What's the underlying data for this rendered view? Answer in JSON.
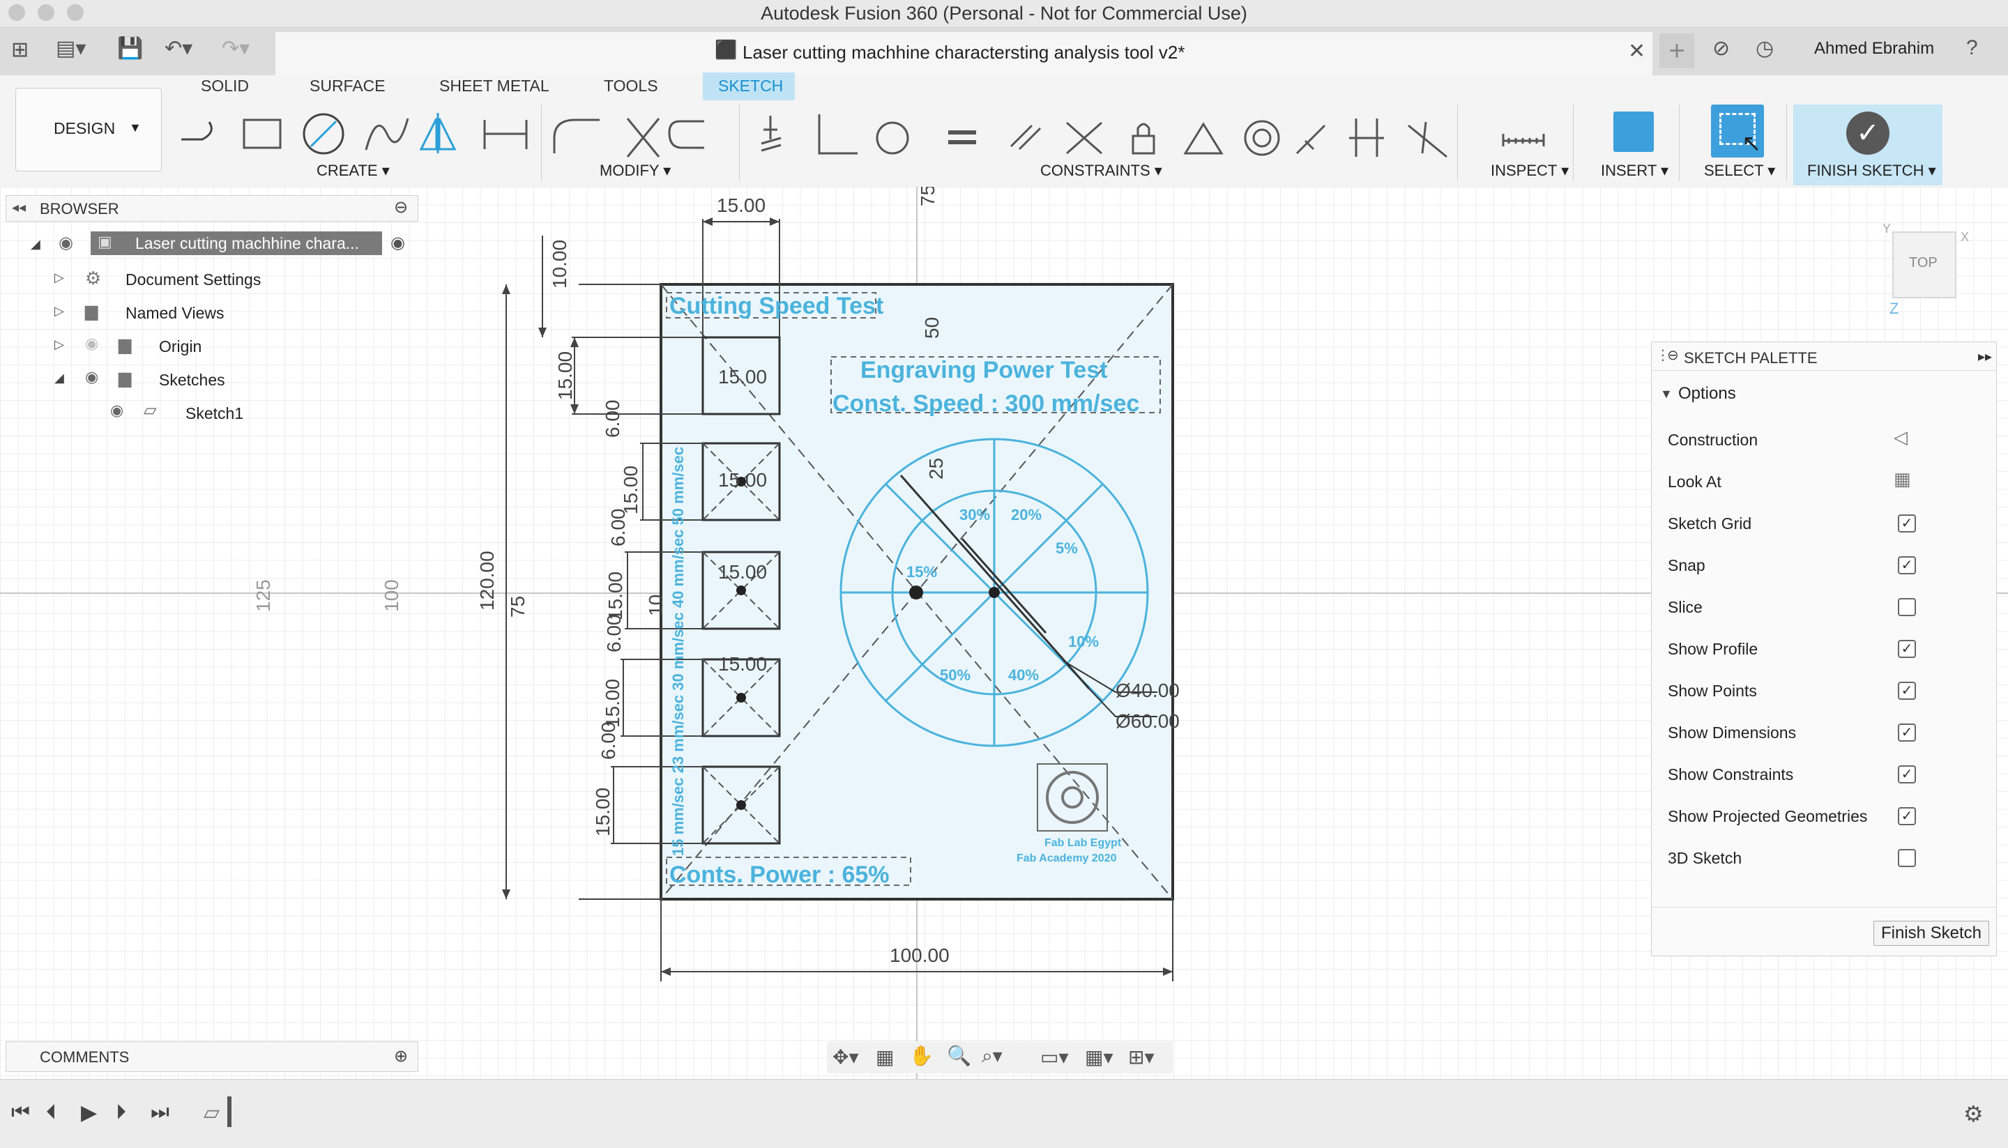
{
  "window": {
    "title": "Autodesk Fusion 360 (Personal - Not for Commercial Use)",
    "document_title": "Laser cutting machhine charactersting analysis tool v2*",
    "user": "Ahmed Ebrahim"
  },
  "ribbon": {
    "workspace": "DESIGN",
    "tabs": [
      "SOLID",
      "SURFACE",
      "SHEET METAL",
      "TOOLS",
      "SKETCH"
    ],
    "active_tab": "SKETCH",
    "groups": {
      "create": "CREATE",
      "modify": "MODIFY",
      "constraints": "CONSTRAINTS",
      "inspect": "INSPECT",
      "insert": "INSERT",
      "select": "SELECT",
      "finish": "FINISH SKETCH"
    }
  },
  "browser": {
    "title": "BROWSER",
    "root": "Laser cutting machhine chara...",
    "items": [
      "Document Settings",
      "Named Views",
      "Origin",
      "Sketches"
    ],
    "sketch": "Sketch1"
  },
  "comments": {
    "title": "COMMENTS"
  },
  "palette": {
    "title": "SKETCH PALETTE",
    "section": "Options",
    "options": [
      {
        "label": "Construction",
        "kind": "icon"
      },
      {
        "label": "Look At",
        "kind": "icon"
      },
      {
        "label": "Sketch Grid",
        "checked": true
      },
      {
        "label": "Snap",
        "checked": true
      },
      {
        "label": "Slice",
        "checked": false
      },
      {
        "label": "Show Profile",
        "checked": true
      },
      {
        "label": "Show Points",
        "checked": true
      },
      {
        "label": "Show Dimensions",
        "checked": true
      },
      {
        "label": "Show Constraints",
        "checked": true
      },
      {
        "label": "Show Projected Geometries",
        "checked": true
      },
      {
        "label": "3D Sketch",
        "checked": false
      }
    ],
    "finish_button": "Finish Sketch"
  },
  "viewcube": {
    "face": "TOP",
    "x": "X",
    "y": "Y",
    "z": "Z"
  },
  "sketch": {
    "title_cutting": "Cutting Speed Test",
    "title_engraving": "Engraving Power Test",
    "subtitle_engraving": "Const. Speed : 300 mm/sec",
    "footer_power": "Conts. Power : 65%",
    "side_labels": "15 mm/sec  23 mm/sec  30 mm/sec  40 mm/sec  50 mm/sec",
    "ring_labels": [
      "30%",
      "20%",
      "5%",
      "10%",
      "40%",
      "50%",
      "15%"
    ],
    "logo_text_1": "Fab Lab Egypt",
    "logo_text_2": "Fab Academy 2020",
    "dimensions": {
      "top_width": "15.00",
      "top_offset": "10.00",
      "box": "15.00",
      "gap": "6.00",
      "height": "120.00",
      "width": "100.00",
      "dia_inner": "Ø40.00",
      "dia_outer": "Ø60.00",
      "dim_75_v": "75",
      "dim_75_h": "75",
      "dim_25": "25",
      "dim_50": "50",
      "dim_10": "10",
      "ruler_125": "125",
      "ruler_100": "100"
    }
  }
}
